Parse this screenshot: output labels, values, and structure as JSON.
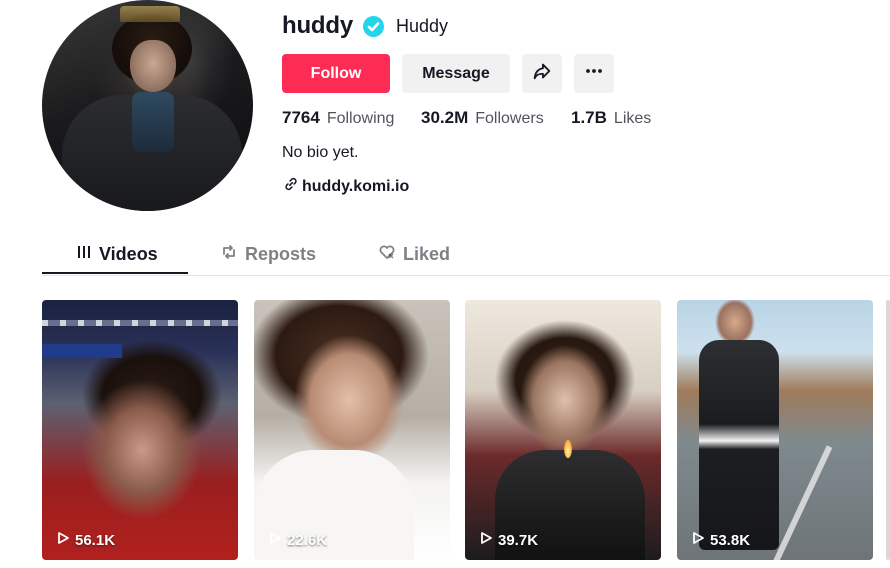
{
  "profile": {
    "username": "huddy",
    "nickname": "Huddy",
    "verified": true,
    "bio": "No bio yet.",
    "link": "huddy.komi.io"
  },
  "actions": {
    "follow_label": "Follow",
    "message_label": "Message",
    "share_icon": "share-icon",
    "more_icon": "more-icon"
  },
  "stats": {
    "following": {
      "value": "7764",
      "label": "Following"
    },
    "followers": {
      "value": "30.2M",
      "label": "Followers"
    },
    "likes": {
      "value": "1.7B",
      "label": "Likes"
    }
  },
  "tabs": [
    {
      "label": "Videos",
      "icon": "grid-icon",
      "active": true
    },
    {
      "label": "Reposts",
      "icon": "repost-icon",
      "active": false
    },
    {
      "label": "Liked",
      "icon": "heart-icon",
      "active": false
    }
  ],
  "videos": [
    {
      "views": "56.1K"
    },
    {
      "views": "22.6K"
    },
    {
      "views": "39.7K"
    },
    {
      "views": "53.8K"
    }
  ],
  "colors": {
    "accent": "#fe2c55",
    "verified": "#20d5ec",
    "text": "#161823"
  }
}
